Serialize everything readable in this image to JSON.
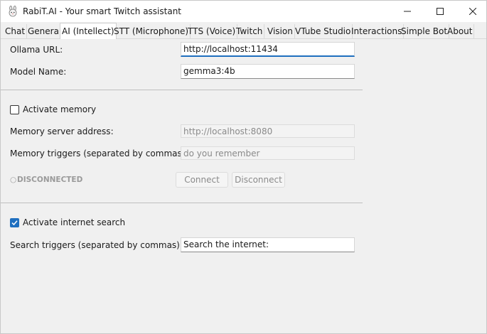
{
  "window": {
    "title": "RabiT.AI - Your smart Twitch assistant"
  },
  "tabs": [
    {
      "label": "Chat",
      "active": false
    },
    {
      "label": "General",
      "active": false
    },
    {
      "label": "AI (Intellect)",
      "active": true
    },
    {
      "label": "STT (Microphone)",
      "active": false
    },
    {
      "label": "TTS (Voice)",
      "active": false
    },
    {
      "label": "Twitch",
      "active": false
    },
    {
      "label": "Vision",
      "active": false
    },
    {
      "label": "VTube Studio",
      "active": false
    },
    {
      "label": "Interactions",
      "active": false
    },
    {
      "label": "Simple Bot",
      "active": false
    },
    {
      "label": "About",
      "active": false
    }
  ],
  "ollama": {
    "url_label": "Ollama URL:",
    "url_value": "http://localhost:11434",
    "model_label": "Model Name:",
    "model_value": "gemma3:4b"
  },
  "memory": {
    "activate_label": "Activate memory",
    "activate_checked": false,
    "server_label": "Memory server address:",
    "server_value": "http://localhost:8080",
    "triggers_label": "Memory triggers (separated by commas):",
    "triggers_value": "do you remember",
    "status_icon": "○",
    "status_text": "DISCONNECTED",
    "connect_label": "Connect",
    "disconnect_label": "Disconnect"
  },
  "search": {
    "activate_label": "Activate internet search",
    "activate_checked": true,
    "triggers_label": "Search triggers (separated by commas):",
    "triggers_value": "Search the internet:"
  }
}
